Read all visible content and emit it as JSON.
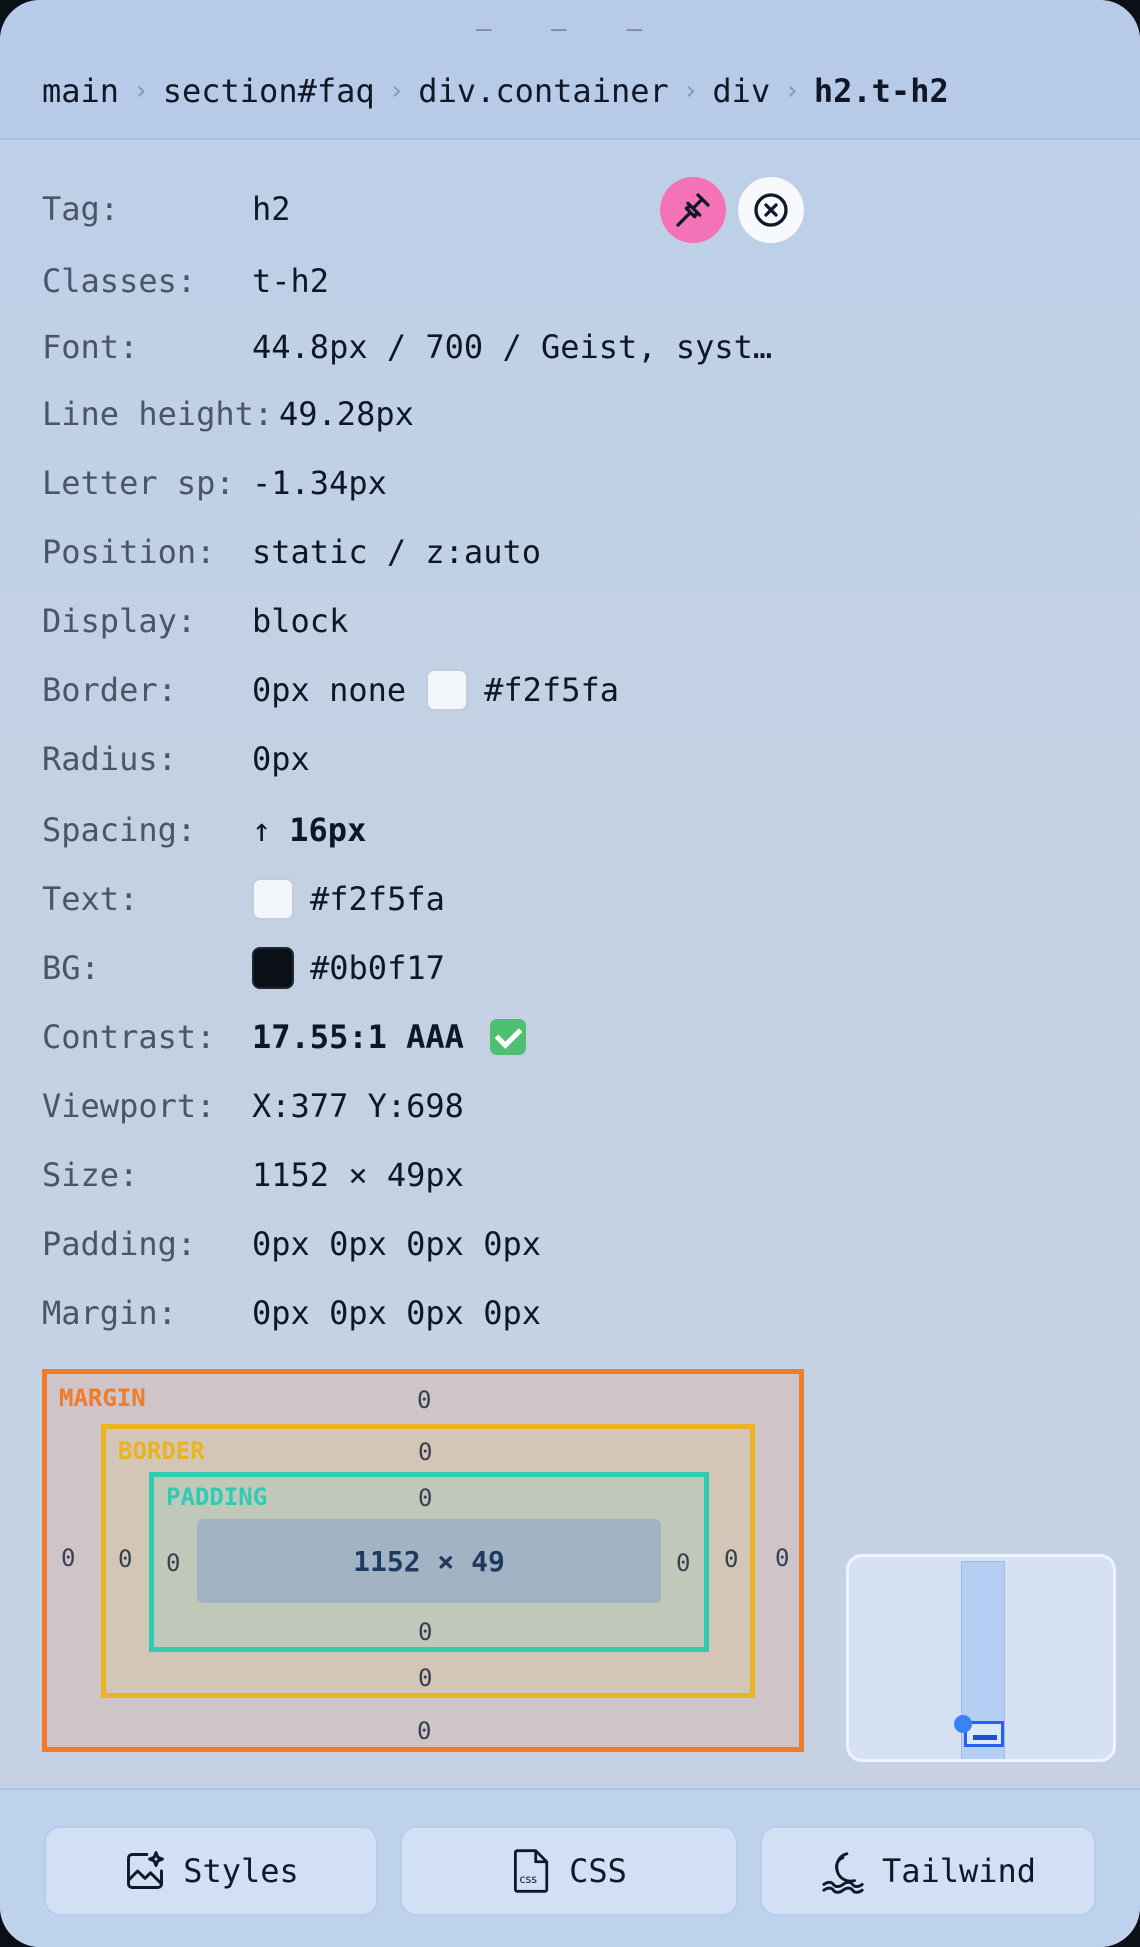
{
  "header": {
    "drag_handle": "— — —",
    "breadcrumb": [
      "main",
      "section#faq",
      "div.container",
      "div",
      "h2.t-h2"
    ],
    "separator": "›"
  },
  "actions": {
    "pin_icon": "pin-icon",
    "close_icon": "close-circle-icon"
  },
  "props": {
    "tag": {
      "label": "Tag:",
      "value": "h2"
    },
    "classes": {
      "label": "Classes:",
      "value": "t-h2"
    },
    "font": {
      "label": "Font:",
      "value": "44.8px / 700 / Geist, syst…"
    },
    "line_height": {
      "label": "Line height:",
      "value": "49.28px"
    },
    "letter_spacing": {
      "label": "Letter sp:",
      "value": "-1.34px"
    },
    "position": {
      "label": "Position:",
      "value": "static / z:auto"
    },
    "display": {
      "label": "Display:",
      "value": "block"
    },
    "border": {
      "label": "Border:",
      "value": "0px none",
      "color": "#f2f5fa"
    },
    "radius": {
      "label": "Radius:",
      "value": "0px"
    },
    "spacing": {
      "label": "Spacing:",
      "arrow": "↑",
      "value": "16px"
    },
    "text": {
      "label": "Text:",
      "color": "#f2f5fa"
    },
    "bg": {
      "label": "BG:",
      "color": "#0b0f17"
    },
    "contrast": {
      "label": "Contrast:",
      "value": "17.55:1 AAA"
    },
    "viewport": {
      "label": "Viewport:",
      "value": "X:377 Y:698"
    },
    "size": {
      "label": "Size:",
      "value": "1152 × 49px"
    },
    "padding": {
      "label": "Padding:",
      "value": "0px 0px 0px 0px"
    },
    "margin": {
      "label": "Margin:",
      "value": "0px 0px 0px 0px"
    }
  },
  "box_model": {
    "margin": {
      "title": "MARGIN",
      "top": "0",
      "right": "0",
      "bottom": "0",
      "left": "0",
      "color": "#f07b28"
    },
    "border": {
      "title": "BORDER",
      "top": "0",
      "right": "0",
      "bottom": "0",
      "left": "0",
      "color": "#e9b322"
    },
    "padding": {
      "title": "PADDING",
      "top": "0",
      "right": "0",
      "bottom": "0",
      "left": "0",
      "color": "#2fcbb3"
    },
    "content": "1152 × 49"
  },
  "footer": {
    "styles": {
      "label": "Styles",
      "icon": "sparkle-image-icon"
    },
    "css": {
      "label": "CSS",
      "icon": "css-file-icon"
    },
    "tailwind": {
      "label": "Tailwind",
      "icon": "wave-icon"
    }
  }
}
